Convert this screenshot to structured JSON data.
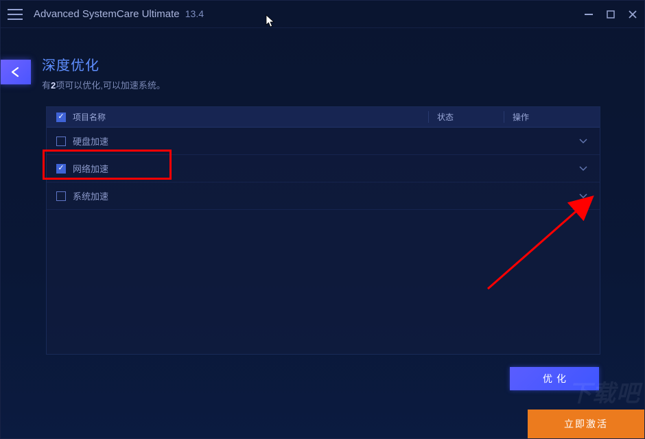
{
  "titlebar": {
    "app_name": "Advanced SystemCare Ultimate",
    "version": "13.4"
  },
  "page": {
    "title": "深度优化",
    "subtitle_prefix": "有",
    "subtitle_count": "2",
    "subtitle_suffix": "项可以优化,可以加速系统。"
  },
  "table": {
    "header": {
      "name": "项目名称",
      "status": "状态",
      "action": "操作"
    },
    "rows": [
      {
        "label": "硬盘加速",
        "checked": false
      },
      {
        "label": "网络加速",
        "checked": true
      },
      {
        "label": "系统加速",
        "checked": false
      }
    ]
  },
  "buttons": {
    "optimize": "优化",
    "activate": "立即激活"
  },
  "watermark": "下载吧",
  "annotations": {
    "highlight_row_index": 1
  }
}
